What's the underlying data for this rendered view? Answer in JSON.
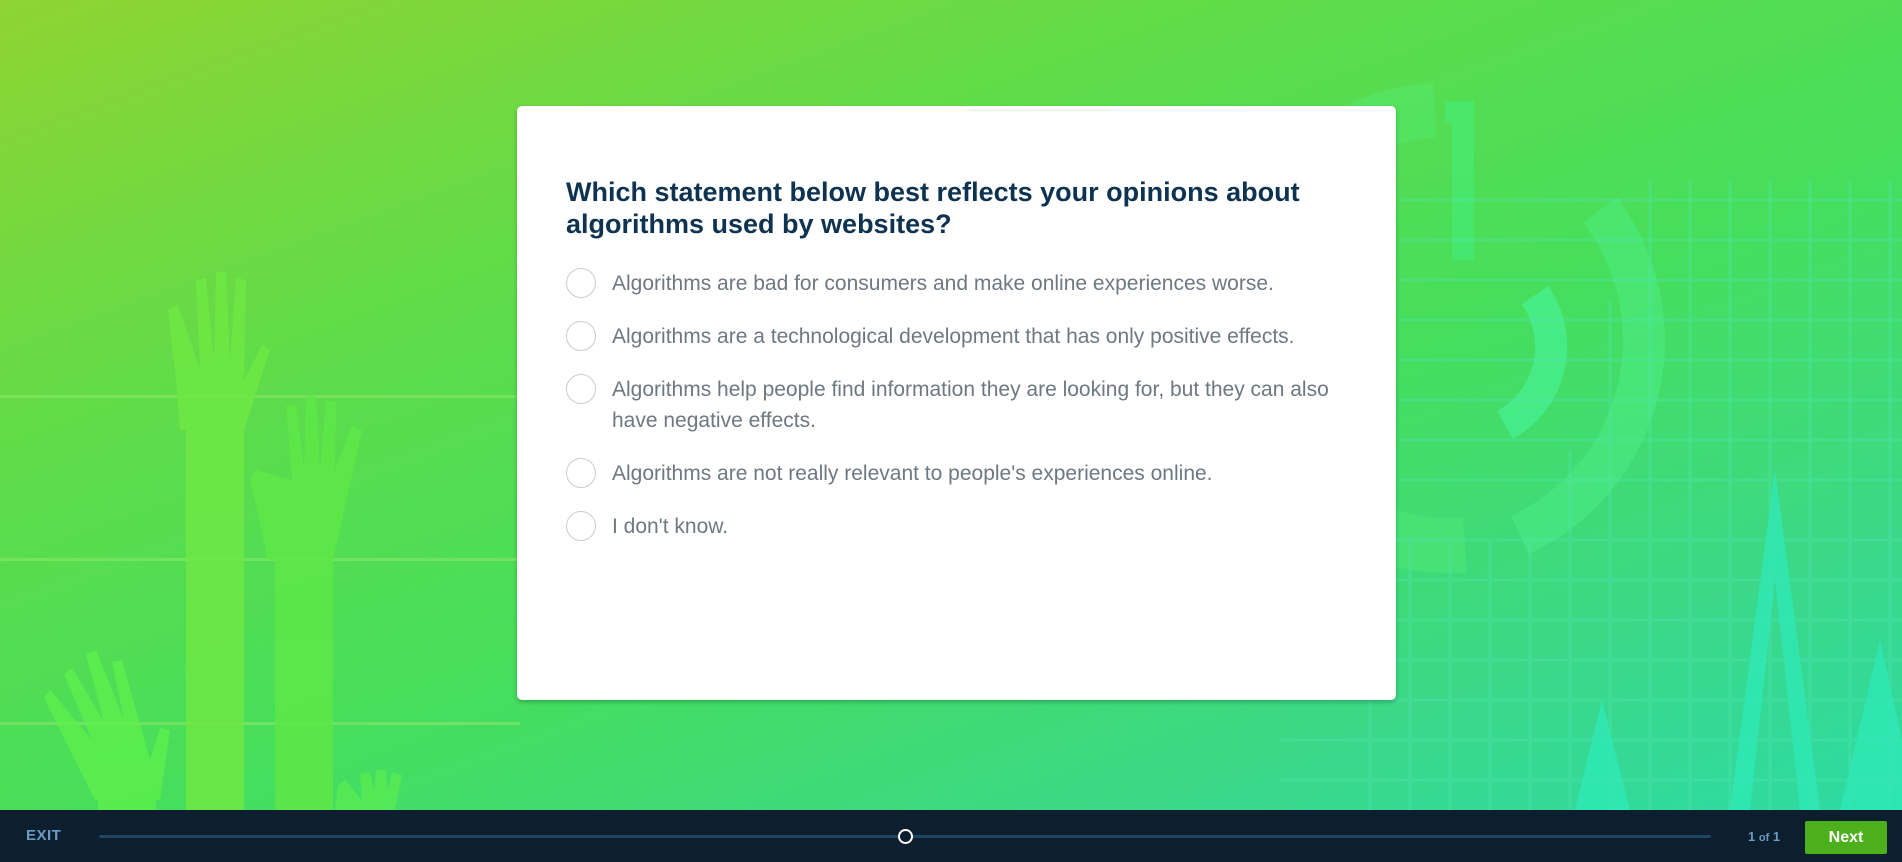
{
  "survey": {
    "question": "Which statement below best reflects your opinions about algorithms used by websites?",
    "options": [
      "Algorithms are bad for consumers and make online experiences worse.",
      "Algorithms are a technological development that has only positive effects.",
      "Algorithms help people find information they are looking for, but they can also have negative effects.",
      "Algorithms are not really relevant to people's experiences online.",
      "I don't know."
    ]
  },
  "footer": {
    "exit_label": "EXIT",
    "page_current": "1",
    "page_of": "of",
    "page_total": "1",
    "next_label": "Next",
    "progress_fraction": 0.5
  },
  "colors": {
    "question_text": "#0e3350",
    "option_text": "#6e7882",
    "footer_bg": "#0d1f2e",
    "next_button": "#4cb01c",
    "footer_text": "#6a9bc4"
  },
  "icons": {
    "option_marker": "radio-circle",
    "progress_marker": "progress-handle-ring"
  }
}
